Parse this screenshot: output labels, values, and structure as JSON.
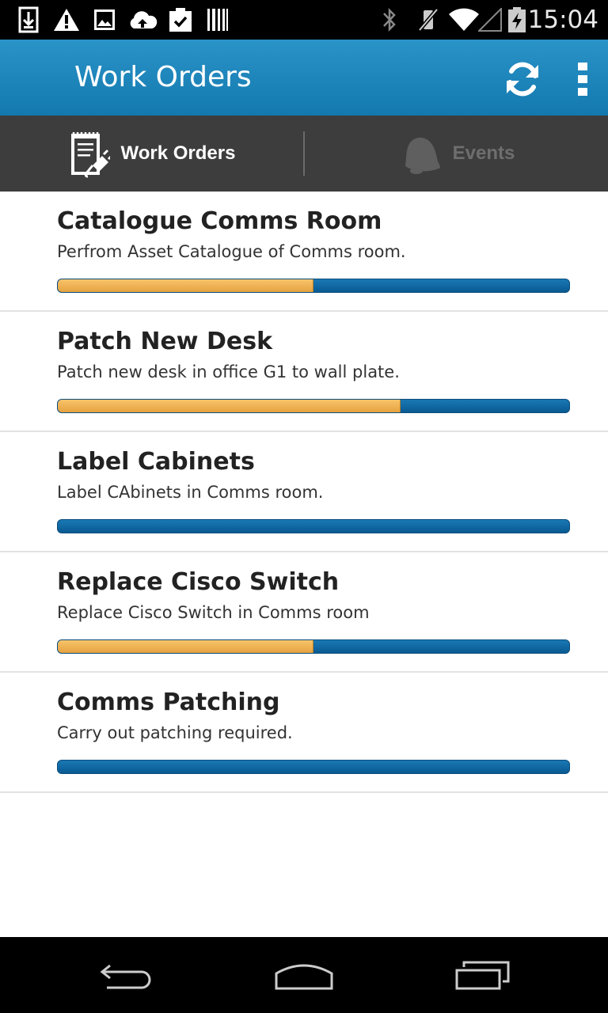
{
  "status_bar": {
    "time": "15:04",
    "icons": [
      "download-icon",
      "warning-icon",
      "image-icon",
      "cloud-upload-icon",
      "clipboard-check-icon",
      "barcode-icon",
      "bluetooth-icon",
      "vibrate-icon",
      "wifi-icon",
      "signal-icon",
      "battery-charging-icon"
    ]
  },
  "action_bar": {
    "title": "Work Orders",
    "refresh_icon": "refresh-icon",
    "overflow_icon": "overflow-menu-icon"
  },
  "tabs": [
    {
      "label": "Work Orders",
      "icon": "clipboard-plug-icon",
      "active": true
    },
    {
      "label": "Events",
      "icon": "bell-icon",
      "active": false
    }
  ],
  "work_orders": [
    {
      "title": "Catalogue Comms Room",
      "description": "Perfrom Asset Catalogue of Comms room.",
      "progress": 0.5
    },
    {
      "title": "Patch New Desk",
      "description": "Patch new desk in office G1 to wall plate.",
      "progress": 0.67
    },
    {
      "title": "Label Cabinets",
      "description": "Label CAbinets in Comms room.",
      "progress": 0
    },
    {
      "title": "Replace Cisco Switch",
      "description": "Replace Cisco Switch in Comms room",
      "progress": 0.5
    },
    {
      "title": "Comms Patching",
      "description": "Carry out patching required.",
      "progress": 0
    }
  ],
  "colors": {
    "action_bar": "#1e86bd",
    "tab_bar": "#3d3d3d",
    "progress_done": "#f0b352",
    "progress_remaining": "#0d659f"
  },
  "nav_bar": {
    "icons": [
      "back-icon",
      "home-icon",
      "recent-apps-icon"
    ]
  }
}
